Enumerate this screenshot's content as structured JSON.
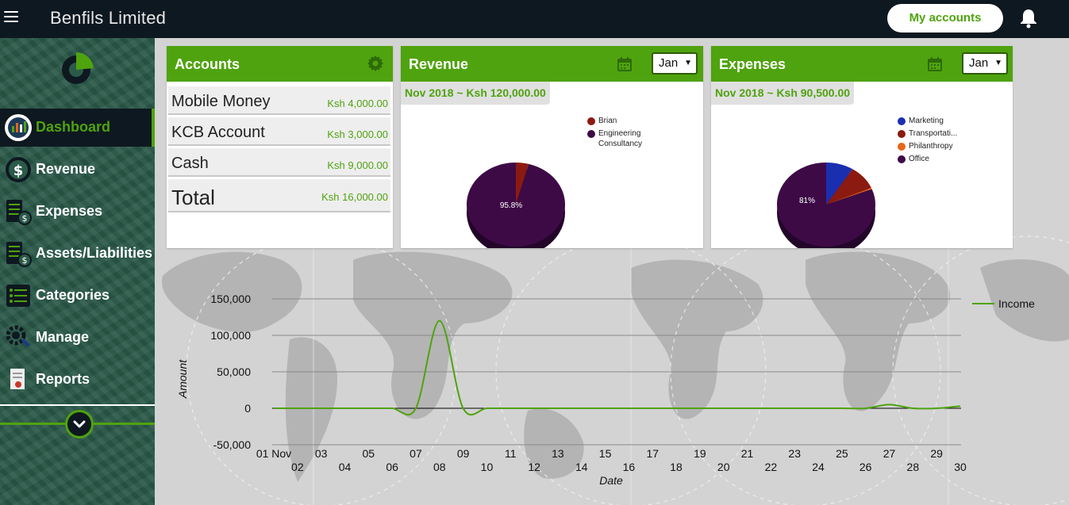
{
  "header": {
    "app_title": "Benfils Limited",
    "my_accounts_label": "My accounts"
  },
  "sidebar": {
    "items": [
      {
        "label": "Dashboard",
        "icon": "dashboard-icon",
        "active": true
      },
      {
        "label": "Revenue",
        "icon": "revenue-icon"
      },
      {
        "label": "Expenses",
        "icon": "expenses-icon"
      },
      {
        "label": "Assets/Liabilities",
        "icon": "assets-liabilities-icon"
      },
      {
        "label": "Categories",
        "icon": "categories-icon"
      },
      {
        "label": "Manage",
        "icon": "manage-icon"
      },
      {
        "label": "Reports",
        "icon": "reports-icon"
      }
    ]
  },
  "colors": {
    "accent": "#4fa30e",
    "header_bg": "#0e1820",
    "pie_purple": "#3d0a46",
    "pie_red": "#8b1a10",
    "pie_blue": "#1a2fb0",
    "pie_orange": "#e8661b"
  },
  "accounts": {
    "title": "Accounts",
    "rows": [
      {
        "name": "Mobile Money",
        "value": "Ksh 4,000.00"
      },
      {
        "name": "KCB Account",
        "value": "Ksh 3,000.00"
      },
      {
        "name": "Cash",
        "value": "Ksh 9,000.00"
      }
    ],
    "total": {
      "name": "Total",
      "value": "Ksh 16,000.00"
    }
  },
  "revenue": {
    "title": "Revenue",
    "month": "Jan",
    "period_text": "Nov 2018 ~ Ksh 120,000.00",
    "pie_label": "95.8%",
    "legend": [
      "Brian",
      "Engineering",
      "Consultancy"
    ]
  },
  "expenses": {
    "title": "Expenses",
    "month": "Jan",
    "period_text": "Nov 2018 ~ Ksh 90,500.00",
    "pie_label": "81%",
    "legend": [
      "Marketing",
      "Transportati...",
      "Philanthropy",
      "Office"
    ]
  },
  "chart_data": [
    {
      "type": "pie",
      "categories": [
        "Brian",
        "Engineering Consultancy"
      ],
      "values": [
        4.2,
        95.8
      ],
      "colors": [
        "#8b1a10",
        "#3d0a46"
      ],
      "legend_position": "right"
    },
    {
      "type": "pie",
      "categories": [
        "Marketing",
        "Transportati...",
        "Philanthropy",
        "Office"
      ],
      "values": [
        9,
        9.5,
        0.5,
        81
      ],
      "colors": [
        "#1a2fb0",
        "#8b1a10",
        "#e8661b",
        "#3d0a46"
      ],
      "legend_position": "right"
    },
    {
      "type": "line",
      "x": [
        "01 Nov",
        "02",
        "03",
        "04",
        "05",
        "06",
        "07",
        "08",
        "09",
        "10",
        "11",
        "12",
        "13",
        "14",
        "15",
        "16",
        "17",
        "18",
        "19",
        "20",
        "21",
        "22",
        "23",
        "24",
        "25",
        "26",
        "27",
        "28",
        "29",
        "30"
      ],
      "series": [
        {
          "name": "Income",
          "color": "#4fa30e",
          "values": [
            0,
            0,
            0,
            0,
            0,
            0,
            0,
            120000,
            0,
            0,
            0,
            0,
            0,
            0,
            0,
            0,
            0,
            0,
            0,
            0,
            0,
            0,
            0,
            0,
            0,
            0,
            5000,
            0,
            0,
            3000
          ]
        }
      ],
      "y_ticks": [
        "150,000",
        "100,000",
        "50,000",
        "0",
        "-50,000"
      ],
      "ylim": [
        -50000,
        150000
      ],
      "xlabel": "Date",
      "ylabel": "Amount",
      "legend_position": "top-right",
      "grid": true
    }
  ]
}
